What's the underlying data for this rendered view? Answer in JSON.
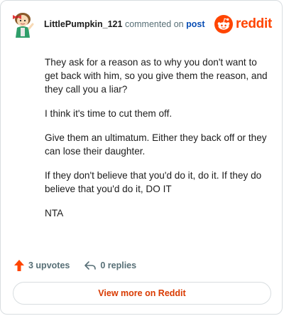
{
  "header": {
    "username": "LittlePumpkin_121",
    "action_text": "commented on",
    "post_link": "post",
    "brand_name": "reddit"
  },
  "comment": {
    "paragraphs": [
      "They ask for a reason as to why you don't want to get back with him, so you give them the reason, and they call you a liar?",
      "I think it's time to cut them off.",
      "Give them an ultimatum. Either they back off or they can lose their daughter.",
      "If they don't believe that you'd do it, do it. If they do believe that you'd do it, DO IT",
      "NTA"
    ]
  },
  "footer": {
    "upvotes": "3 upvotes",
    "replies": "0 replies",
    "view_more": "View more on Reddit"
  },
  "icons": {
    "avatar": "avatar-icon",
    "brand": "reddit-logo-icon",
    "upvote": "upvote-arrow-icon",
    "reply": "reply-arrow-icon"
  },
  "colors": {
    "brand": "#ff4500",
    "link": "#0a4fb5",
    "muted": "#576f76",
    "text": "#1c1c1c",
    "button_text": "#d93a00",
    "border": "#d8dde0"
  }
}
